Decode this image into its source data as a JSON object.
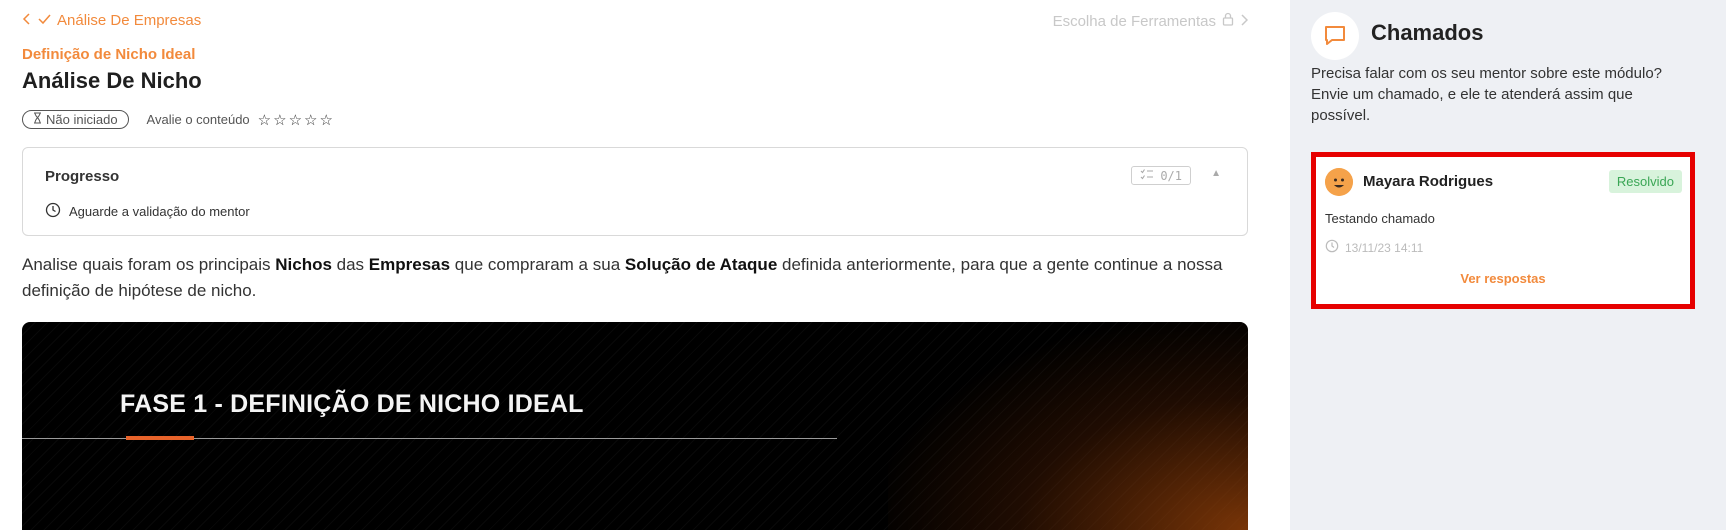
{
  "nav": {
    "prev_label": "Análise De Empresas",
    "next_label": "Escolha de Ferramentas"
  },
  "lesson": {
    "subtitle": "Definição de Nicho Ideal",
    "title": "Análise De Nicho",
    "status": "Não iniciado",
    "rate_label": "Avalie o conteúdo",
    "stars_total": 5
  },
  "progress": {
    "title": "Progresso",
    "wait_text": "Aguarde a validação do mentor",
    "count": "0/1"
  },
  "description": {
    "parts": [
      {
        "text": "Analise quais foram os principais ",
        "bold": false
      },
      {
        "text": "Nichos",
        "bold": true
      },
      {
        "text": " das ",
        "bold": false
      },
      {
        "text": "Empresas",
        "bold": true
      },
      {
        "text": " que compraram a sua ",
        "bold": false
      },
      {
        "text": "Solução de Ataque",
        "bold": true
      },
      {
        "text": " definida anteriormente, para que a gente continue a nossa definição de hipótese de nicho.",
        "bold": false
      }
    ]
  },
  "video": {
    "heading": "FASE 1 - DEFINIÇÃO DE NICHO IDEAL"
  },
  "sidebar": {
    "title": "Chamados",
    "description": "Precisa falar com os seu mentor sobre este módulo? Envie um chamado, e ele te atenderá assim que possível.",
    "ticket": {
      "user": "Mayara Rodrigues",
      "status": "Resolvido",
      "message": "Testando chamado",
      "timestamp": "13/11/23 14:11",
      "link": "Ver respostas"
    }
  },
  "colors": {
    "accent": "#f28a3c",
    "highlight_border": "#e60000",
    "resolved_bg": "#d8f3dc",
    "resolved_text": "#3aa655",
    "sidebar_bg": "#eef0f4"
  }
}
